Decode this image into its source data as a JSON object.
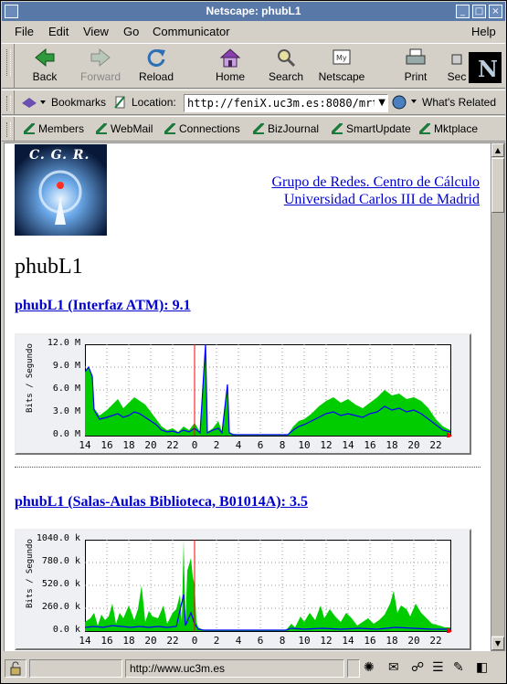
{
  "window": {
    "title": "Netscape: phubL1"
  },
  "menu": [
    "File",
    "Edit",
    "View",
    "Go",
    "Communicator",
    "Help"
  ],
  "nav": {
    "back": "Back",
    "forward": "Forward",
    "reload": "Reload",
    "home": "Home",
    "search": "Search",
    "netscape": "Netscape",
    "print": "Print",
    "security": "Sec"
  },
  "location": {
    "bookmarks": "Bookmarks",
    "label": "Location:",
    "url": "http://feniX.uc3m.es:8080/mrt",
    "whats_related": "What's Related"
  },
  "personal": [
    "Members",
    "WebMail",
    "Connections",
    "BizJournal",
    "SmartUpdate",
    "Mktplace"
  ],
  "page": {
    "logo_text": "C. G. R.",
    "org_line1": "Grupo de Redes. Centro de Cálculo",
    "org_line2": "Universidad Carlos III de Madrid",
    "heading": "phubL1"
  },
  "graphs": [
    {
      "title": "phubL1 (Interfaz ATM): 9.1",
      "yaxis_label": "Bits / Segundo",
      "y_ticks": [
        "12.0 M",
        "9.0 M",
        "6.0 M",
        "3.0 M",
        "0.0 M"
      ],
      "x_ticks": [
        "14",
        "16",
        "18",
        "20",
        "22",
        "0",
        "2",
        "4",
        "6",
        "8",
        "10",
        "12",
        "14",
        "16",
        "18",
        "20",
        "22"
      ]
    },
    {
      "title": "phubL1 (Salas-Aulas Biblioteca, B01014A): 3.5",
      "yaxis_label": "Bits / Segundo",
      "y_ticks": [
        "1040.0 k",
        "780.0 k",
        "520.0 k",
        "260.0 k",
        "0.0 k"
      ],
      "x_ticks": [
        "14",
        "16",
        "18",
        "20",
        "22",
        "0",
        "2",
        "4",
        "6",
        "8",
        "10",
        "12",
        "14",
        "16",
        "18",
        "20",
        "22"
      ]
    }
  ],
  "status": {
    "url": "http://www.uc3m.es"
  },
  "colors": {
    "inbound": "#00cc00",
    "outbound": "#0000ff",
    "now_marker": "#ff0000",
    "link": "#0000cc"
  }
}
